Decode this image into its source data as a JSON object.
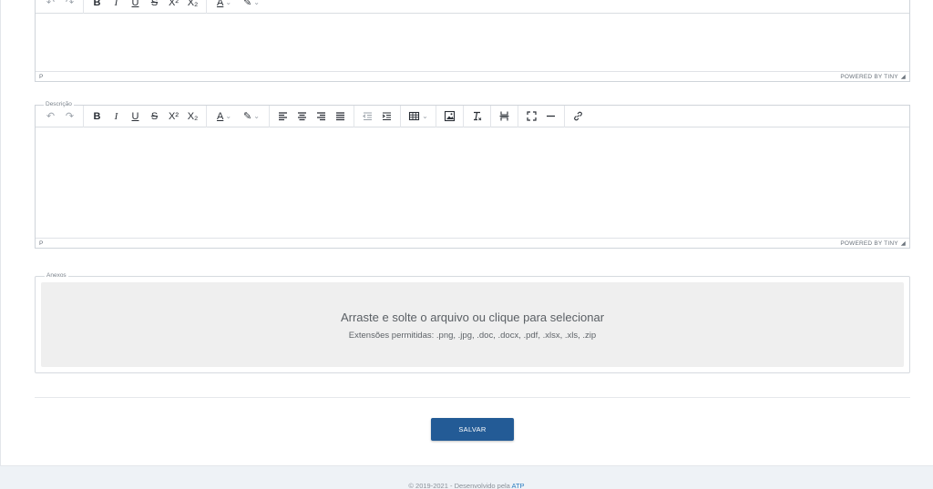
{
  "editors": [
    {
      "label": "",
      "status_path": "P",
      "powered_by": "POWERED BY TINY"
    },
    {
      "label": "Descrição",
      "status_path": "P",
      "powered_by": "POWERED BY TINY"
    }
  ],
  "toolbar": {
    "undo": "↶",
    "redo": "↷",
    "bold": "B",
    "italic": "I",
    "underline": "U",
    "strikethrough": "S",
    "superscript": "X²",
    "subscript": "X₂",
    "text_color": "A",
    "caret": "⌄"
  },
  "attachments": {
    "legend": "Anexos",
    "dropzone_title": "Arraste e solte o arquivo ou clique para selecionar",
    "dropzone_sub": "Extensões permitidas: .png, .jpg, .doc, .docx, .pdf, .xlsx, .xls, .zip"
  },
  "actions": {
    "save_label": "SALVAR"
  },
  "footer": {
    "text": "© 2019-2021 - Desenvolvido pela ",
    "link": "ATP"
  },
  "colors": {
    "primary": "#235b96",
    "dropzone_bg": "#efefef",
    "page_bg": "#eef2f6"
  }
}
